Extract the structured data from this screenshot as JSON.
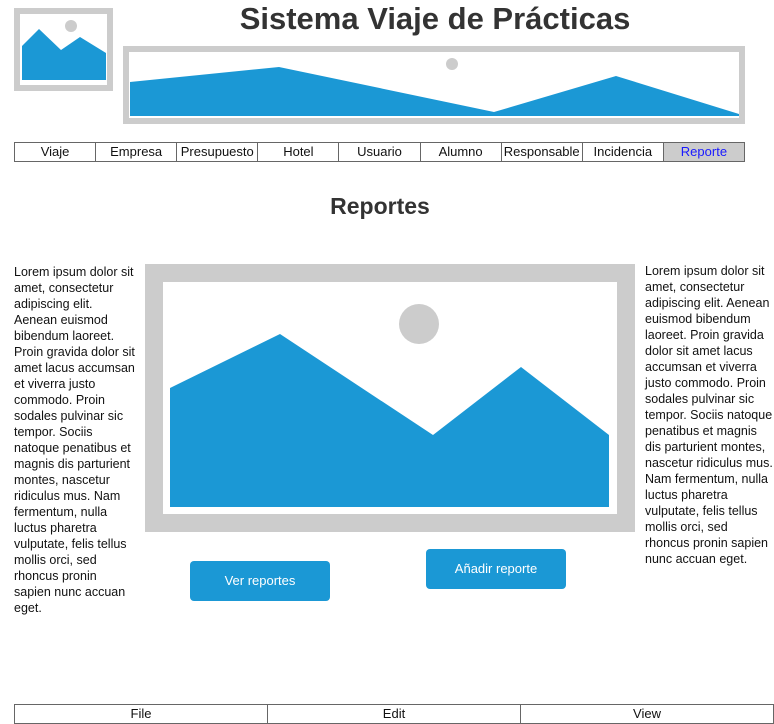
{
  "header": {
    "title": "Sistema Viaje de Prácticas"
  },
  "images": {
    "logo_icon": "image-placeholder-icon",
    "banner_icon": "image-placeholder-icon",
    "hero_icon": "image-placeholder-icon",
    "fill_color": "#1b98d5",
    "frame_color": "#cccccc"
  },
  "nav": {
    "active": "Reporte",
    "active_color": "#1a1aff",
    "items": [
      {
        "label": "Viaje"
      },
      {
        "label": "Empresa"
      },
      {
        "label": "Presupuesto"
      },
      {
        "label": "Hotel"
      },
      {
        "label": "Usuario"
      },
      {
        "label": "Alumno"
      },
      {
        "label": "Responsable"
      },
      {
        "label": "Incidencia"
      },
      {
        "label": "Reporte"
      }
    ]
  },
  "main": {
    "section_title": "Reportes",
    "left_text": "Lorem ipsum dolor sit amet, consectetur adipiscing elit. Aenean euismod bibendum laoreet. Proin gravida dolor sit amet lacus accumsan et viverra justo commodo. Proin sodales pulvinar sic tempor. Sociis natoque penatibus et magnis dis parturient montes, nascetur ridiculus mus. Nam fermentum, nulla luctus pharetra vulputate, felis tellus mollis orci, sed rhoncus pronin sapien nunc accuan eget.",
    "right_text": "Lorem ipsum dolor sit amet, consectetur adipiscing elit. Aenean euismod bibendum laoreet. Proin gravida dolor sit amet lacus accumsan et viverra justo commodo. Proin sodales pulvinar sic tempor. Sociis natoque penatibus et magnis dis parturient montes, nascetur ridiculus mus. Nam fermentum, nulla luctus pharetra vulputate, felis tellus mollis orci, sed rhoncus pronin sapien nunc accuan eget.",
    "buttons": {
      "view_reports": "Ver reportes",
      "add_report": "Añadir reporte",
      "color": "#1b98d5"
    }
  },
  "bottom_menu": {
    "items": [
      {
        "label": "File"
      },
      {
        "label": "Edit"
      },
      {
        "label": "View"
      }
    ]
  }
}
